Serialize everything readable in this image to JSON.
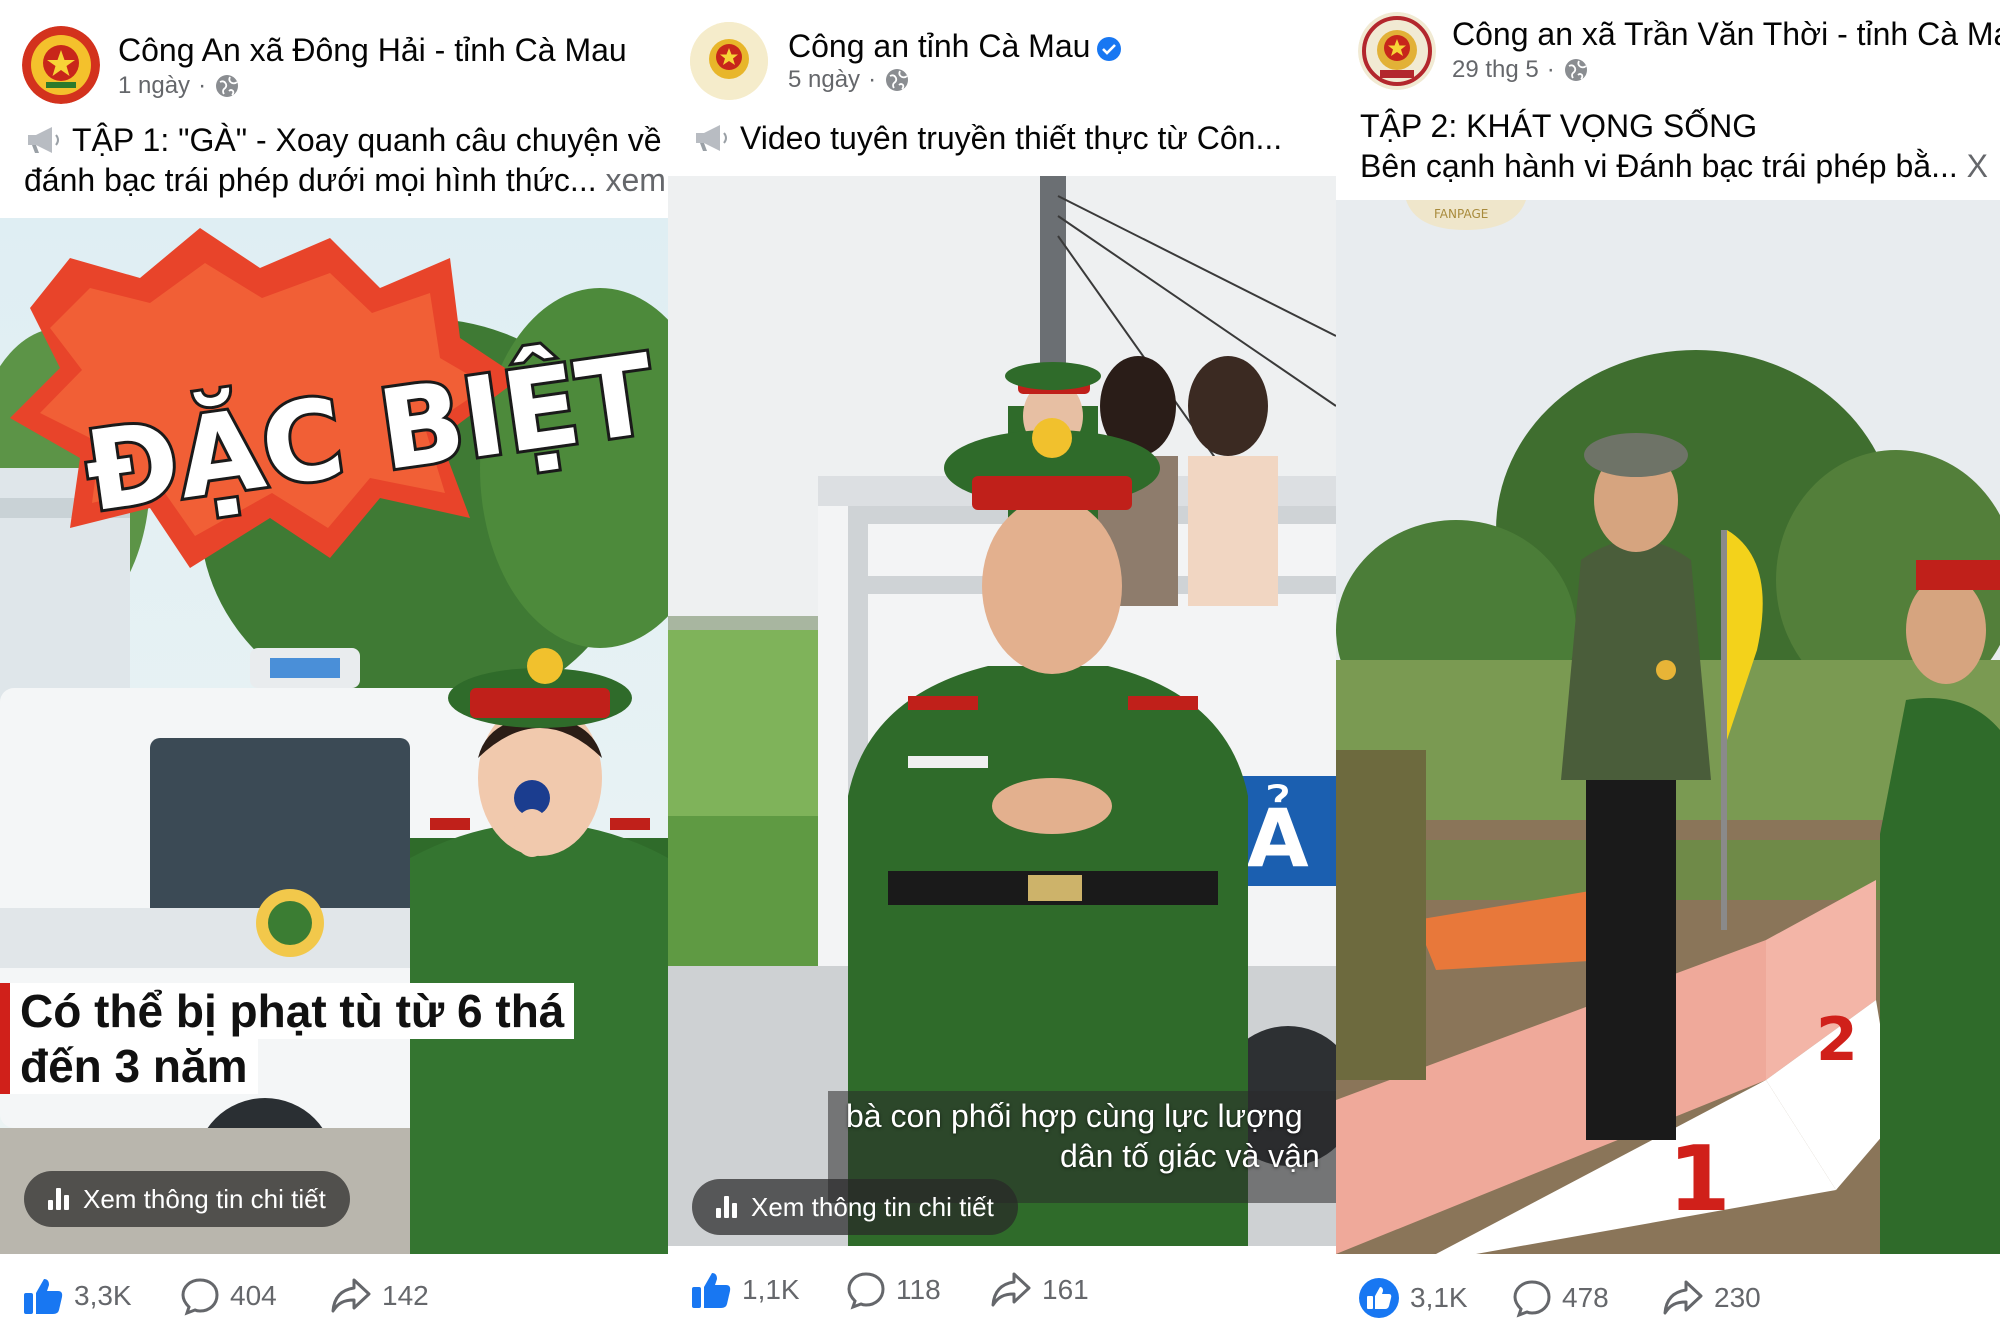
{
  "posts": [
    {
      "page_name": "Công An xã Đông Hải - tỉnh Cà Mau",
      "time": "1 ngày",
      "privacy_icon": "globe-icon",
      "caption_line1": "TẬP 1: \"GÀ\" - Xoay quanh câu chuyện về",
      "caption_line2": "đánh bạc trái phép dưới mọi hình thức...",
      "see_more": "xem",
      "video_title_art": "ĐẶC BIỆT",
      "overlay_line1": "Có thể bị phạt tù từ 6 thá",
      "overlay_line2": "đến 3 năm",
      "info_pill": "Xem thông tin chi tiết",
      "likes": "3,3K",
      "comments": "404",
      "shares": "142"
    },
    {
      "page_name": "Công an tỉnh Cà Mau",
      "verified": true,
      "time": "5 ngày",
      "privacy_icon": "globe-icon",
      "caption_line1": "Video tuyên truyền thiết thực từ Côn...",
      "vehicle_text": "CẢ",
      "subtitle_line1": "bà con phối hợp cùng lực lượng",
      "subtitle_line2": "dân tố giác và vận",
      "info_pill": "Xem thông tin chi tiết",
      "likes": "1,1K",
      "comments": "118",
      "shares": "161"
    },
    {
      "page_name": "Công an xã Trần Văn Thời - tỉnh Cà Mau",
      "time": "29 thg 5",
      "privacy_icon": "globe-icon",
      "caption_line1": "TẬP 2: KHÁT VỌNG SỐNG",
      "caption_line2": "Bên cạnh hành vi Đánh bạc trái phép bằ...",
      "see_more": "X",
      "watermark_text": "FANPAGE",
      "podium_1": "1",
      "podium_2": "2",
      "likes": "3,1K",
      "comments": "478",
      "shares": "230"
    }
  ],
  "colors": {
    "facebook_blue": "#1877f2",
    "text_primary": "#050505",
    "text_secondary": "#65676b",
    "uniform_green": "#2f6b2a",
    "police_red": "#c0201a"
  }
}
